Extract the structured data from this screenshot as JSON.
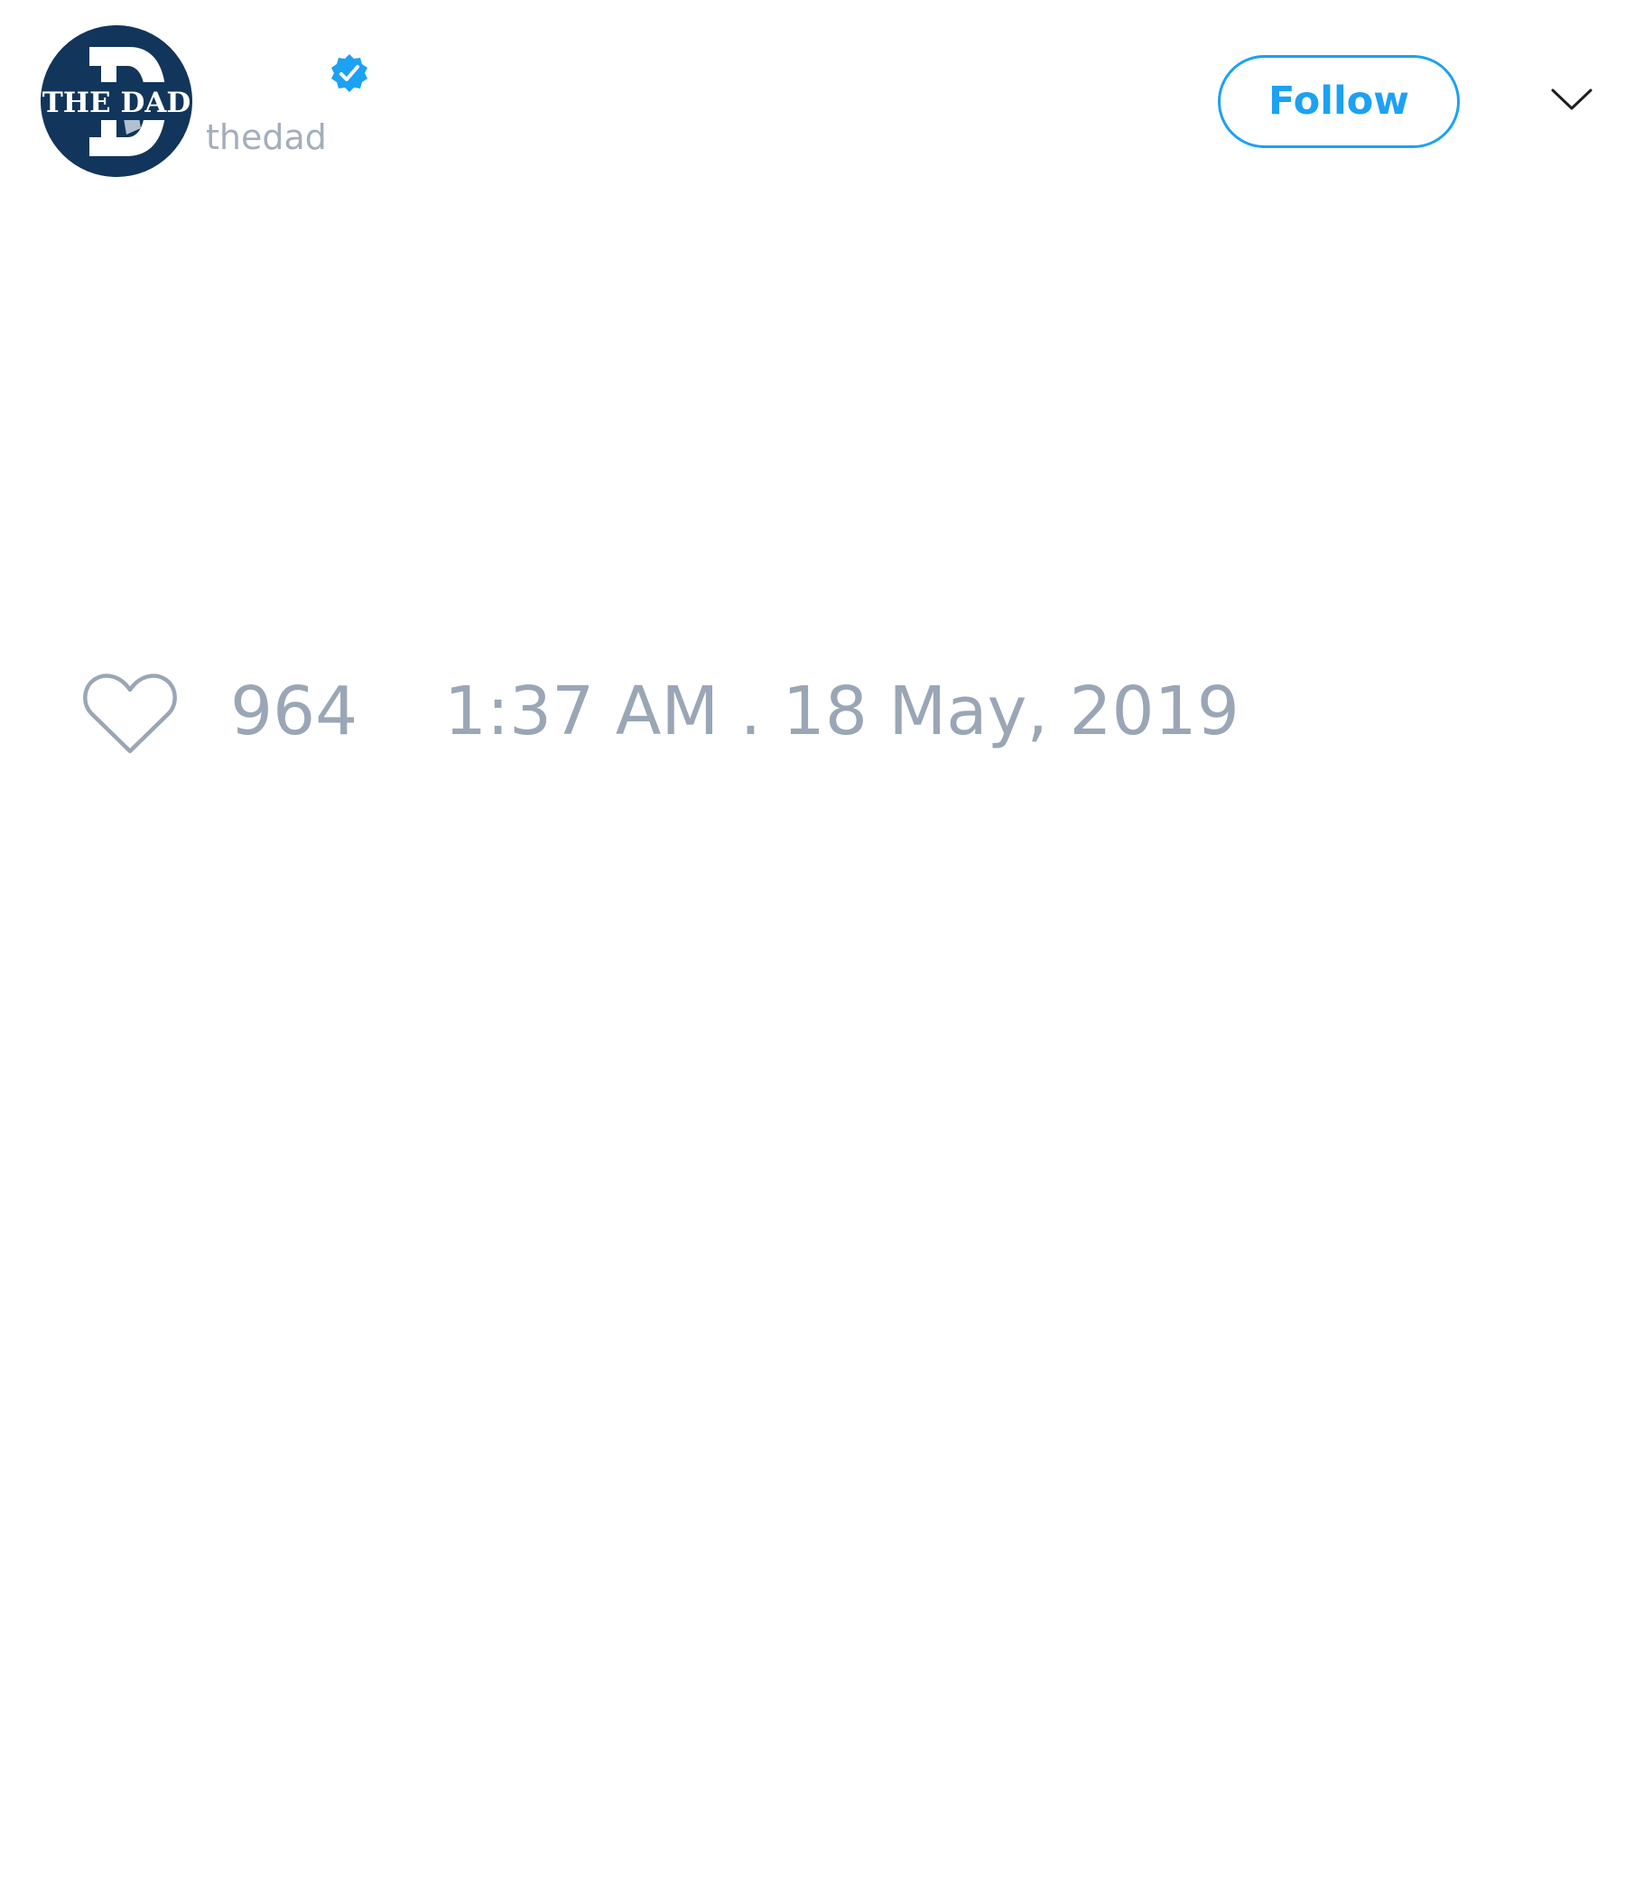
{
  "tweet": {
    "author": {
      "avatar_icon": "the-dad-logo",
      "avatar_text": "THE DAD",
      "verified_icon": "verified-badge-icon",
      "handle": "thedad"
    },
    "follow_label": "Follow",
    "menu_icon": "chevron-down-icon",
    "like_icon": "heart-icon",
    "like_count": "964",
    "timestamp": "1:37 AM . 18 May, 2019"
  },
  "colors": {
    "accent": "#1da1f2",
    "muted_text": "#9aa6b6",
    "avatar_background": "#12355b",
    "background": "#ffffff"
  }
}
